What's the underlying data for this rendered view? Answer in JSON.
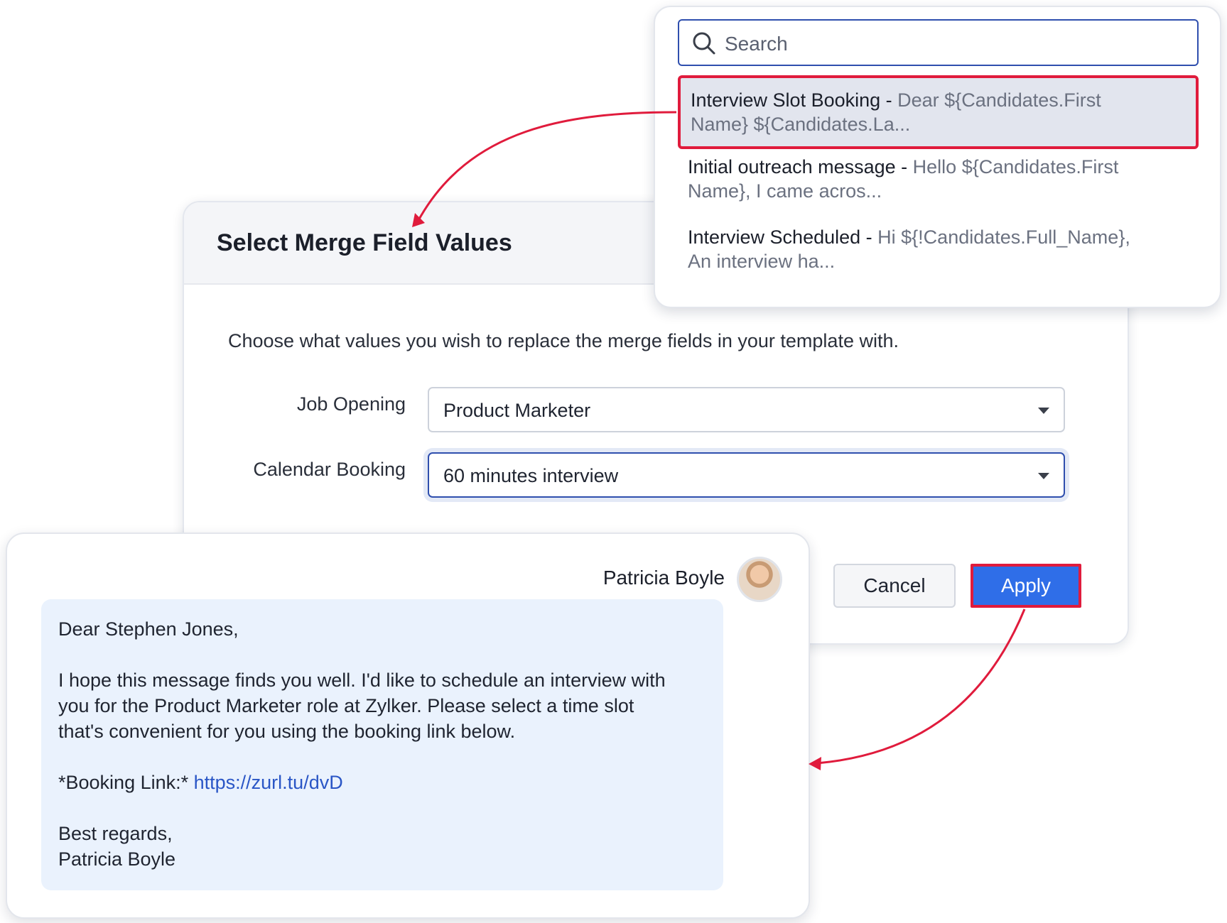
{
  "dropdown": {
    "search_placeholder": "Search",
    "templates": [
      {
        "name": "Interview Slot Booking - ",
        "preview_line1": "Dear ${Candidates.First",
        "preview_line2": "Name} ${Candidates.La..."
      },
      {
        "name": "Initial outreach message - ",
        "preview_line1": "Hello ${Candidates.First",
        "preview_line2": "Name}, I came acros..."
      },
      {
        "name": "Interview Scheduled - ",
        "preview_line1": "Hi ${!Candidates.Full_Name},",
        "preview_line2": "An interview ha..."
      }
    ]
  },
  "dialog": {
    "title": "Select Merge Field Values",
    "description": "Choose what values you wish to replace the merge fields in your template with.",
    "job_opening_label": "Job Opening",
    "job_opening_value": "Product Marketer",
    "calendar_booking_label": "Calendar Booking",
    "calendar_booking_value": "60 minutes interview",
    "cancel_label": "Cancel",
    "apply_label": "Apply"
  },
  "email": {
    "sender_name": "Patricia Boyle",
    "greeting": "Dear Stephen Jones,",
    "body_line1": "I hope this message finds you well. I'd like to schedule an interview with",
    "body_line2": "you for the Product Marketer role at Zylker. Please select a time slot",
    "body_line3": "that's convenient for you using the booking link below.",
    "booking_label": "*Booking Link:* ",
    "booking_url": "https://zurl.tu/dvD",
    "closing": "Best regards,",
    "signature": "Patricia Boyle"
  },
  "colors": {
    "highlight": "#e01b3c",
    "apply_button": "#2f6ee8",
    "focus_border": "#2f4fae",
    "link": "#2a56c6",
    "bubble": "#eaf2fd"
  }
}
